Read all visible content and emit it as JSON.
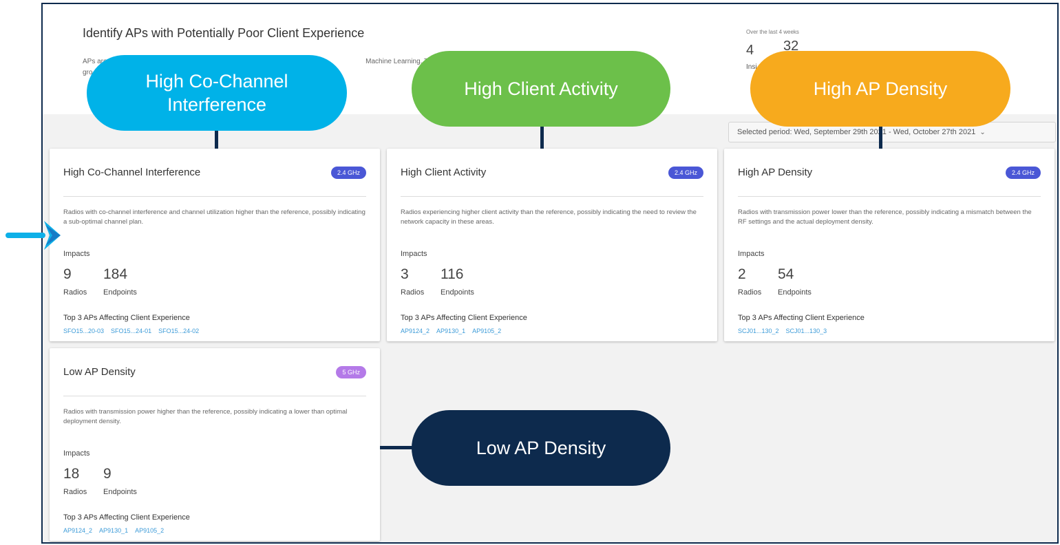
{
  "header": {
    "title": "Identify APs with Potentially Poor Client Experience",
    "description_visible_start": "APs are",
    "description_visible_mid": "Machine Learning. Those",
    "description_visible_line2": "gro",
    "period_label": "Over the last 4 weeks",
    "stat1": "4",
    "stat2": "32",
    "stat1_label": "Insi"
  },
  "selector": {
    "label": "Selected period: Wed, September 29th 2021 - Wed, October 27th 2021"
  },
  "impacts_label": "Impacts",
  "radios_label": "Radios",
  "endpoints_label": "Endpoints",
  "top3_label": "Top 3 APs Affecting Client Experience",
  "cards": [
    {
      "title": "High Co-Channel Interference",
      "band": "2.4 GHz",
      "band_color": "#4a57d6",
      "description": "Radios with co-channel interference and channel utilization higher than the reference, possibly indicating a sub-optimal channel plan.",
      "radios": "9",
      "endpoints": "184",
      "aps": [
        "SFO15...20-03",
        "SFO15...24-01",
        "SFO15...24-02"
      ]
    },
    {
      "title": "High Client Activity",
      "band": "2.4 GHz",
      "band_color": "#4a57d6",
      "description": "Radios experiencing higher client activity than the reference, possibly indicating the need to review the network capacity in these areas.",
      "radios": "3",
      "endpoints": "116",
      "aps": [
        "AP9124_2",
        "AP9130_1",
        "AP9105_2"
      ]
    },
    {
      "title": "High AP Density",
      "band": "2.4 GHz",
      "band_color": "#4a57d6",
      "description": "Radios with transmission power lower than the reference, possibly indicating a mismatch between the RF settings and the actual deployment density.",
      "radios": "2",
      "endpoints": "54",
      "aps": [
        "SCJ01...130_2",
        "SCJ01...130_3"
      ]
    },
    {
      "title": "Low AP Density",
      "band": "5 GHz",
      "band_color": "#b47ae8",
      "description": "Radios with transmission power higher than the reference, possibly indicating a lower than optimal deployment density.",
      "radios": "18",
      "endpoints": "9",
      "aps": [
        "AP9124_2",
        "AP9130_1",
        "AP9105_2"
      ]
    }
  ],
  "callouts": [
    {
      "label": "High Co-Channel Interference",
      "color": "#00b2e8"
    },
    {
      "label": "High Client Activity",
      "color": "#6cc04a"
    },
    {
      "label": "High AP Density",
      "color": "#f7aa1d"
    },
    {
      "label": "Low AP Density",
      "color": "#0d2a4d"
    }
  ],
  "arrow_color": "#0db0e8"
}
